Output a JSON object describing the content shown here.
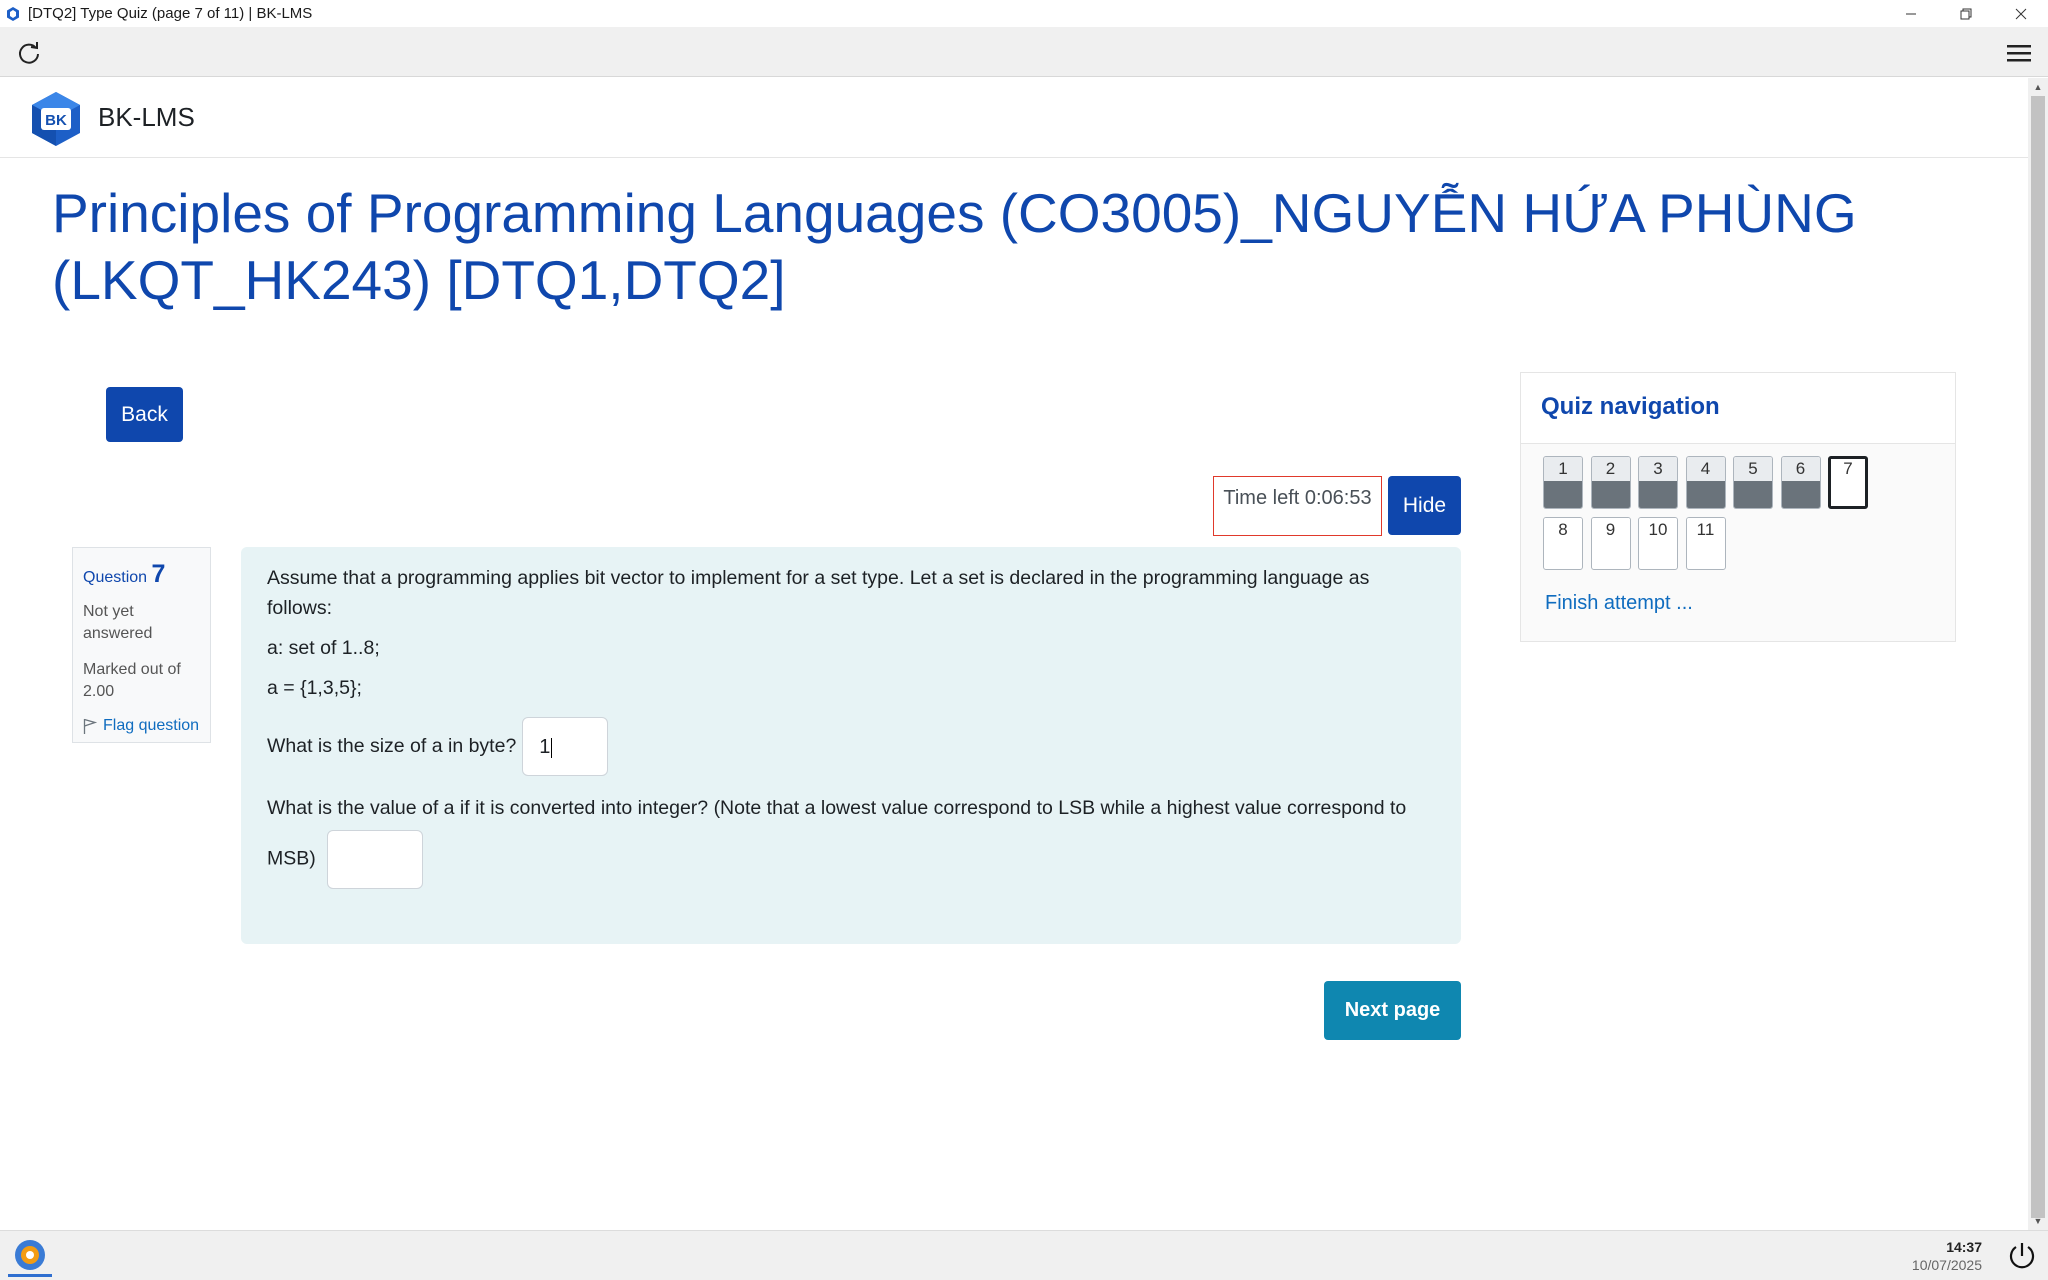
{
  "window": {
    "title": "[DTQ2] Type Quiz (page 7 of 11) | BK-LMS",
    "controls": [
      "minimize-icon",
      "restore-icon",
      "close-icon"
    ]
  },
  "toolbar": {
    "reload_icon": "reload-icon",
    "menu_icon": "hamburger-menu-icon"
  },
  "header": {
    "logo_text": "BK",
    "site_name": "BK-LMS"
  },
  "course": {
    "title": "Principles of Programming Languages (CO3005)_NGUYỄN HỨA PHÙNG (LKQT_HK243) [DTQ1,DTQ2]"
  },
  "actions": {
    "back_label": "Back",
    "hide_label": "Hide",
    "next_label": "Next page"
  },
  "timer": {
    "text": "Time left 0:06:53"
  },
  "question_info": {
    "label": "Question",
    "number": "7",
    "state": "Not yet answered",
    "grade": "Marked out of 2.00",
    "flag_label": "Flag question"
  },
  "question": {
    "intro": "Assume that a programming applies bit vector to implement for a set type. Let a set is declared in the programming language as follows:",
    "decl": "a: set of 1..8;",
    "assign": "a = {1,3,5};",
    "q1": "What is the size of a in byte?",
    "q1_answer": "1",
    "q2": "What is the value of a if it is converted into integer? (Note that a lowest value correspond to LSB while a highest value correspond to MSB)",
    "q2_answer": ""
  },
  "quiz_nav": {
    "title": "Quiz navigation",
    "items": [
      {
        "label": "1",
        "state": "answered"
      },
      {
        "label": "2",
        "state": "answered"
      },
      {
        "label": "3",
        "state": "answered"
      },
      {
        "label": "4",
        "state": "answered"
      },
      {
        "label": "5",
        "state": "answered"
      },
      {
        "label": "6",
        "state": "answered"
      },
      {
        "label": "7",
        "state": "current"
      },
      {
        "label": "8",
        "state": "notyet"
      },
      {
        "label": "9",
        "state": "notyet"
      },
      {
        "label": "10",
        "state": "notyet"
      },
      {
        "label": "11",
        "state": "notyet"
      }
    ],
    "finish_label": "Finish attempt ..."
  },
  "taskbar": {
    "time": "14:37",
    "date": "10/07/2025"
  },
  "colors": {
    "brand_blue": "#0f47ad",
    "next_button": "#0f87b0",
    "question_bg": "#e7f3f5",
    "timer_border": "#e0392b"
  }
}
